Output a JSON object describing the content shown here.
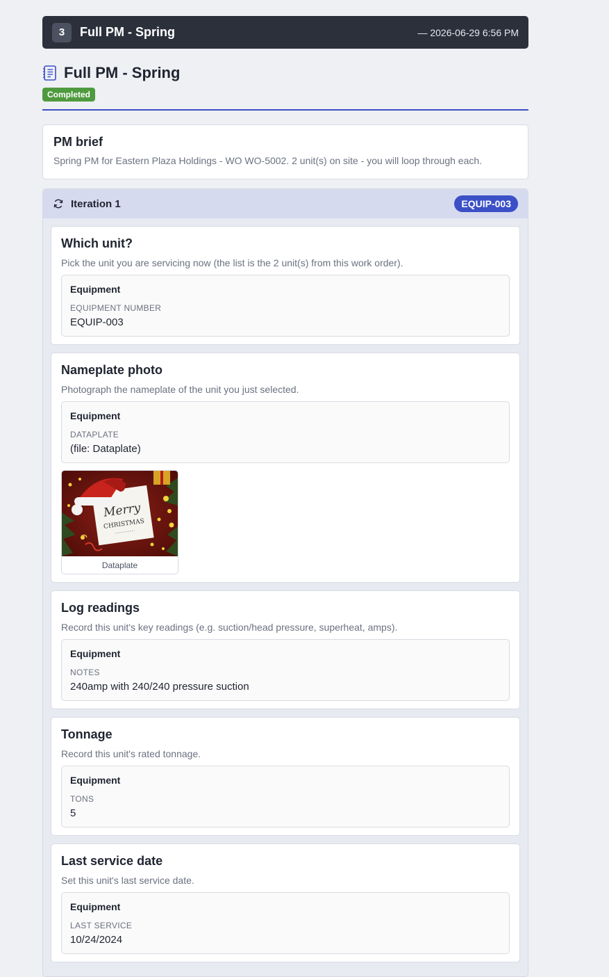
{
  "header": {
    "step_number": "3",
    "title": "Full PM - Spring",
    "timestamp": "— 2026-06-29 6:56 PM"
  },
  "page": {
    "title": "Full PM - Spring",
    "status": "Completed",
    "icon": "document-list-icon"
  },
  "brief": {
    "title": "PM brief",
    "text": "Spring PM for Eastern Plaza Holdings - WO WO-5002. 2 unit(s) on site - you will loop through each."
  },
  "iteration": {
    "label": "Iteration 1",
    "equipment_tag": "EQUIP-003",
    "icon": "refresh-icon"
  },
  "steps": [
    {
      "title": "Which unit?",
      "description": "Pick the unit you are servicing now (the list is the 2 unit(s) from this work order).",
      "group": "Equipment",
      "label": "EQUIPMENT NUMBER",
      "value": "EQUIP-003"
    },
    {
      "title": "Nameplate photo",
      "description": "Photograph the nameplate of the unit you just selected.",
      "group": "Equipment",
      "label": "DATAPLATE",
      "value": "(file: Dataplate)",
      "photo_caption": "Dataplate",
      "photo_text_1": "Merry",
      "photo_text_2": "CHRISTMAS"
    },
    {
      "title": "Log readings",
      "description": "Record this unit's key readings (e.g. suction/head pressure, superheat, amps).",
      "group": "Equipment",
      "label": "NOTES",
      "value": "240amp with 240/240 pressure suction"
    },
    {
      "title": "Tonnage",
      "description": "Record this unit's rated tonnage.",
      "group": "Equipment",
      "label": "TONS",
      "value": "5"
    },
    {
      "title": "Last service date",
      "description": "Set this unit's last service date.",
      "group": "Equipment",
      "label": "LAST SERVICE",
      "value": "10/24/2024"
    }
  ],
  "colors": {
    "header_bg": "#2b303b",
    "accent": "#3b50c7",
    "status_completed": "#4f9a3f"
  }
}
